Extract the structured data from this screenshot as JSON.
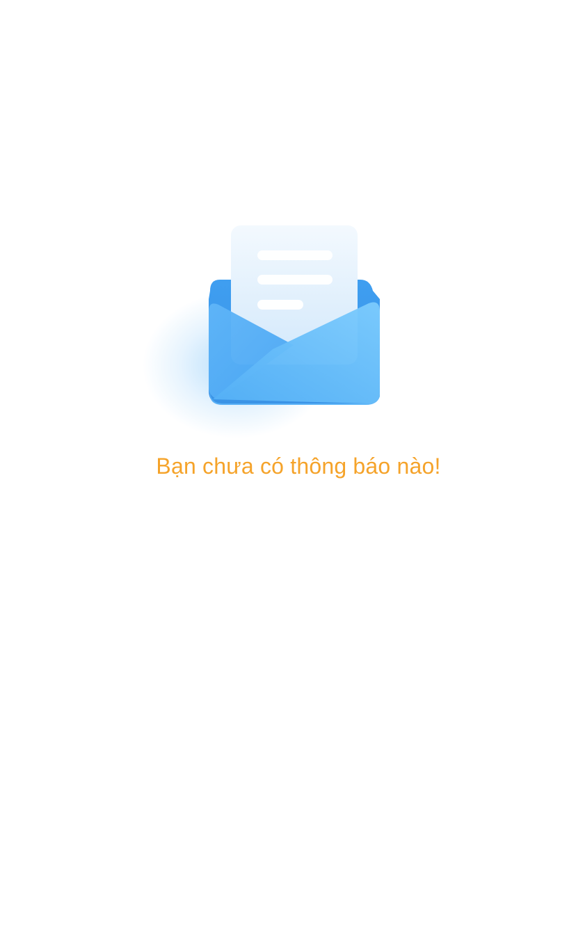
{
  "empty_state": {
    "icon": "open-envelope-letter-icon",
    "message": "Bạn chưa có thông báo nào!"
  },
  "colors": {
    "background": "#ffffff",
    "message_text": "#f5a32a",
    "envelope_blue": "#4aa8f5",
    "envelope_light": "#6ec0fb",
    "letter_paper": "#e6f2fd",
    "letter_lines": "#ffffff"
  }
}
